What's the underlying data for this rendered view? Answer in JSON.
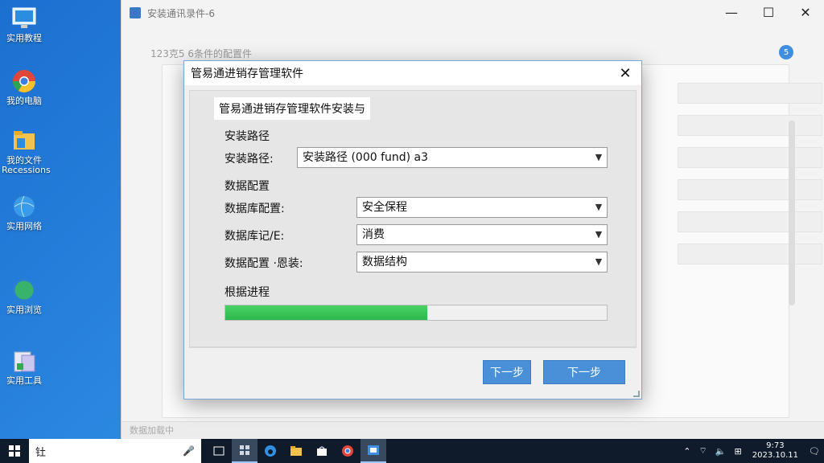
{
  "desktop": {
    "icons": [
      {
        "label": "实用教程"
      },
      {
        "label": "我的电脑"
      },
      {
        "label": "我的文件 Recessions"
      },
      {
        "label": "实用网络"
      },
      {
        "label": "实用浏览"
      },
      {
        "label": "实用工具"
      }
    ]
  },
  "background_window": {
    "title": "安装通讯录件-6",
    "subtitle": "123克5 6条件的配置件",
    "badge": "5",
    "status": "数据加载中"
  },
  "dialog": {
    "title": "管易通进销存管理软件",
    "heading": "管易通进销存管理软件安装与",
    "section_install": "安装路径",
    "install_path_label": "安装路径:",
    "install_path_value": "安装路径 (000 fund) a3",
    "section_data": "数据配置",
    "db_config_label": "数据库配置:",
    "db_config_value": "安全保程",
    "db_record_label": "数据库记/E:",
    "db_record_value": "消费",
    "data_install_label": "数据配置 ·恩装:",
    "data_install_value": "数据结构",
    "progress_label": "根据进程",
    "progress_fraction": 0.53,
    "buttons": {
      "back": "下一步",
      "next": "下一步"
    },
    "close_glyph": "✕"
  },
  "taskbar": {
    "search_text": "钍",
    "clock_time": "9:73",
    "clock_date": "2023.10.11"
  },
  "colors": {
    "accent": "#4a90d9",
    "progress": "#2db84b",
    "taskbar": "#0f1b2b"
  }
}
